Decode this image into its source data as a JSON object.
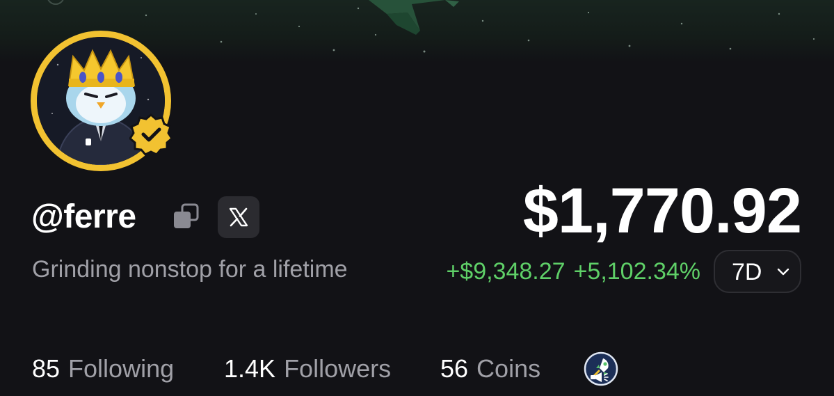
{
  "profile": {
    "handle": "@ferre",
    "bio": "Grinding nonstop for a lifetime",
    "avatar_icon": "crowned-penguin-avatar",
    "verified_icon": "verified-check-icon",
    "copy_icon": "copy-icon",
    "x_icon": "x-logo-icon"
  },
  "portfolio": {
    "balance": "$1,770.92",
    "change_amount": "+$9,348.27",
    "change_percent": "+5,102.34%",
    "period": "7D",
    "positive_color": "#5fd068"
  },
  "stats": {
    "following_count": "85",
    "following_label": "Following",
    "followers_count": "1.4K",
    "followers_label": "Followers",
    "coins_count": "56",
    "coins_label": "Coins",
    "badge_icon": "rocket-launch-badge-icon"
  },
  "colors": {
    "background": "#121216",
    "avatar_ring": "#f2c231",
    "muted_text": "#a0a0a7"
  }
}
